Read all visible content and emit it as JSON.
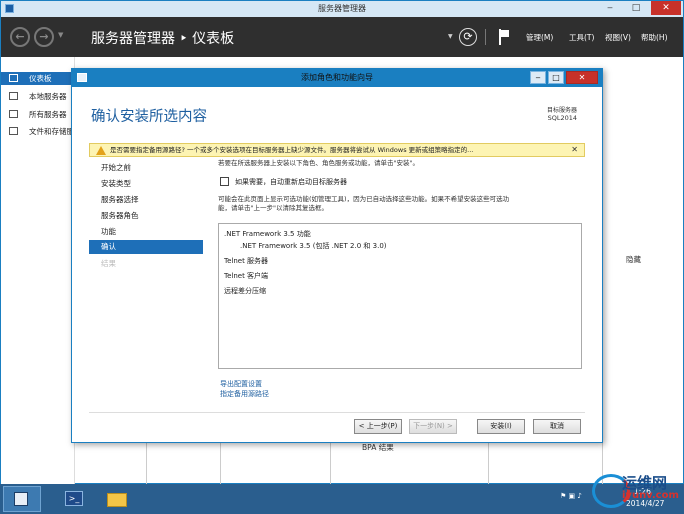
{
  "server_manager": {
    "window_title": "服务器管理器",
    "title": "服务器管理器",
    "title_sep": "‣",
    "title_page": "仪表板",
    "menus": [
      "管理(M)",
      "工具(T)",
      "视图(V)",
      "帮助(H)"
    ],
    "window_controls": {
      "minimize": "‒",
      "maximize": "□",
      "close": "✕"
    },
    "left_nav": [
      "仪表板",
      "本地服务器",
      "所有服务器",
      "文件和存储服务"
    ],
    "bg_hide": "隐藏",
    "bg_bpa": "BPA 结果"
  },
  "wizard": {
    "window_title": "添加角色和功能向导",
    "heading": "确认安装所选内容",
    "target_label": "目标服务器",
    "target_value": "SQL2014",
    "warning": "是否需要指定备用源路径? 一个或多个安装选项在目标服务器上缺少源文件。服务器将尝试从 Windows 更新或组策略指定的...",
    "steps": [
      "开始之前",
      "安装类型",
      "服务器选择",
      "服务器角色",
      "功能",
      "确认",
      "结果"
    ],
    "intro": "若要在所选服务器上安装以下角色、角色服务或功能，请单击\"安装\"。",
    "restart_label": "如果需要，自动重新启动目标服务器",
    "note_line1": "可能会在此页面上显示可选功能(如管理工具)，因为已自动选择这些功能。如果不希望安装这些可选功",
    "note_line2": "能，请单击\"上一步\"以清除其复选框。",
    "features": [
      ".NET Framework 3.5 功能",
      ".NET Framework 3.5 (包括 .NET 2.0 和 3.0)",
      "Telnet 服务器",
      "Telnet 客户端",
      "远程差分压缩"
    ],
    "links": {
      "export": "导出配置设置",
      "alt_source": "指定备用源路径"
    },
    "buttons": {
      "prev": "< 上一步(P)",
      "next": "下一步(N) >",
      "install": "安装(I)",
      "cancel": "取消"
    },
    "window_controls": {
      "minimize": "‒",
      "maximize": "□",
      "close": "✕"
    }
  },
  "taskbar": {
    "time": "1:26",
    "date": "2014/4/27",
    "ps_glyph": ">_"
  },
  "watermark": {
    "cn": "运维网",
    "en": "iyunv.com"
  }
}
